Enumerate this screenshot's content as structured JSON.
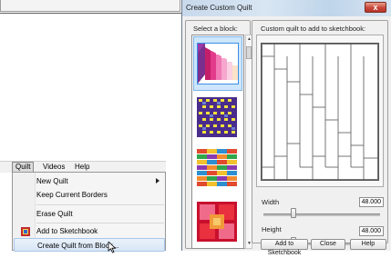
{
  "dialog": {
    "title": "Create Custom Quilt",
    "close_label": "x",
    "select_block_label": "Select a block:",
    "custom_quilt_label": "Custom quilt to add to sketchbook:",
    "width_label": "Width",
    "width_value": "48.000",
    "height_label": "Height",
    "height_value": "48.000",
    "buttons": {
      "add": "Add to Sketchbook",
      "close": "Close",
      "help": "Help"
    }
  },
  "menubar": {
    "items": [
      "Quilt",
      "Videos",
      "Help"
    ]
  },
  "menu": {
    "items": [
      "New Quilt",
      "Keep Current Borders",
      "Erase Quilt",
      "Add to Sketchbook",
      "Create Quilt from Block..."
    ]
  },
  "colors": {
    "accent": "#3a8ee6",
    "highlight": "#d8e6f6"
  }
}
